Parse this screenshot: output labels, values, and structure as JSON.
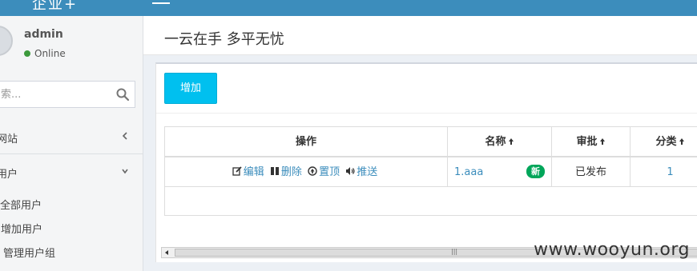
{
  "brand": {
    "text": "企业+"
  },
  "user": {
    "name": "admin",
    "status": "Online",
    "status_color": "#3c9a3c"
  },
  "search": {
    "placeholder": "索..."
  },
  "sidebar": {
    "items": [
      {
        "label": "网站",
        "icon": "chevron-left-icon"
      },
      {
        "label": "用户",
        "icon": "chevron-down-icon"
      }
    ],
    "submenu": [
      {
        "label": "全部用户"
      },
      {
        "label": "增加用户"
      },
      {
        "label": "管理用户组"
      }
    ]
  },
  "header": {
    "title": "一云在手 多平无忧"
  },
  "toolbar": {
    "add_label": "增加"
  },
  "table": {
    "columns": [
      "操作",
      "名称",
      "审批",
      "分类"
    ],
    "rows": [
      {
        "actions": [
          "编辑",
          "删除",
          "置顶",
          "推送"
        ],
        "name": "1.aaa",
        "badge": "新",
        "approval": "已发布",
        "category": "1"
      }
    ]
  },
  "watermark": "www.wooyun.org",
  "colors": {
    "accent": "#3c8dbc",
    "button": "#00c0ef",
    "badge": "#00a65a"
  }
}
